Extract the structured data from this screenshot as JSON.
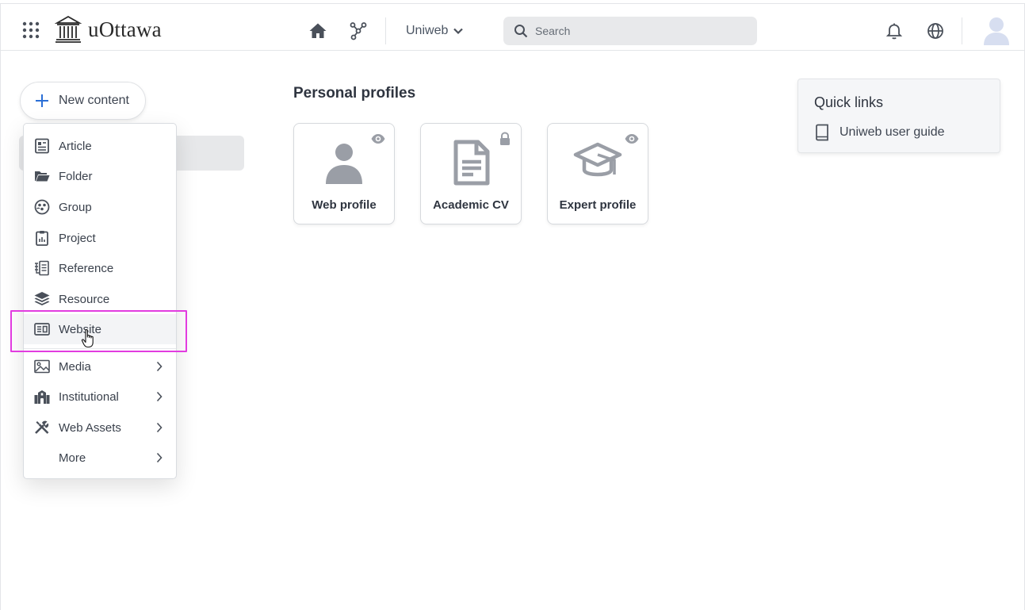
{
  "header": {
    "logo_text": "uOttawa",
    "workspace_label": "Uniweb",
    "search_placeholder": "Search"
  },
  "new_content": {
    "label": "New content"
  },
  "menu": {
    "items": [
      {
        "label": "Article",
        "icon": "article-icon"
      },
      {
        "label": "Folder",
        "icon": "folder-open-icon"
      },
      {
        "label": "Group",
        "icon": "group-icon"
      },
      {
        "label": "Project",
        "icon": "project-clipboard-icon"
      },
      {
        "label": "Reference",
        "icon": "reference-icon"
      },
      {
        "label": "Resource",
        "icon": "layers-icon"
      },
      {
        "label": "Website",
        "icon": "website-icon"
      },
      {
        "label": "Media",
        "icon": "image-icon"
      },
      {
        "label": "Institutional",
        "icon": "institution-icon"
      },
      {
        "label": "Web Assets",
        "icon": "tools-icon"
      },
      {
        "label": "More",
        "icon": ""
      }
    ],
    "hovered": "Website"
  },
  "profiles": {
    "title": "Personal profiles",
    "cards": [
      {
        "label": "Web profile",
        "icon": "person-icon",
        "badge": "eye-icon"
      },
      {
        "label": "Academic CV",
        "icon": "document-icon",
        "badge": "lock-icon"
      },
      {
        "label": "Expert profile",
        "icon": "graduation-cap-icon",
        "badge": "eye-icon"
      }
    ]
  },
  "quick_links": {
    "title": "Quick links",
    "links": [
      {
        "label": "Uniweb user guide",
        "icon": "book-icon"
      }
    ]
  },
  "colors": {
    "accent": "#2b6fd6",
    "icon_gray": "#9a9ea6",
    "callout": "#e23ce0"
  }
}
